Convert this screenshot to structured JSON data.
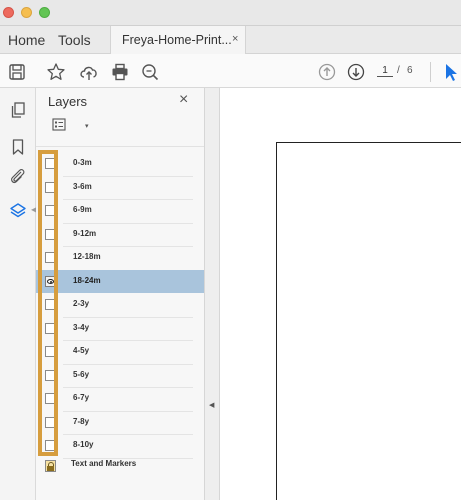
{
  "window": {
    "colors": {
      "close": "#ed6a5e",
      "minimize": "#f5be4f",
      "zoom": "#62c554"
    }
  },
  "menubar": {
    "home_label": "Home",
    "tools_label": "Tools",
    "tab": {
      "label": "Freya-Home-Print...",
      "close": "×"
    }
  },
  "toolbar": {
    "icons": [
      "save-icon",
      "bookmark-star-icon",
      "upload-cloud-icon",
      "print-icon",
      "zoom-search-icon",
      "page-up-icon",
      "page-down-icon",
      "select-cursor-icon"
    ],
    "current_page": "1",
    "separator": "/",
    "total_pages": "6",
    "accent_color": "#1b74e4"
  },
  "leftrail": {
    "icons": [
      "pages-icon",
      "bookmark-icon",
      "attachment-icon",
      "layers-icon"
    ],
    "active": "layers-icon"
  },
  "panel": {
    "title": "Layers",
    "close": "×",
    "options_caret": "▾",
    "layers": [
      {
        "label": "0-3m",
        "visible": false
      },
      {
        "label": "3-6m",
        "visible": false
      },
      {
        "label": "6-9m",
        "visible": false
      },
      {
        "label": "9-12m",
        "visible": false
      },
      {
        "label": "12-18m",
        "visible": false
      },
      {
        "label": "18-24m",
        "visible": true,
        "selected": true
      },
      {
        "label": "2-3y",
        "visible": false
      },
      {
        "label": "3-4y",
        "visible": false
      },
      {
        "label": "4-5y",
        "visible": false
      },
      {
        "label": "5-6y",
        "visible": false
      },
      {
        "label": "6-7y",
        "visible": false
      },
      {
        "label": "7-8y",
        "visible": false
      },
      {
        "label": "8-10y",
        "visible": false
      }
    ],
    "markers_label": "Text and Markers",
    "selected_color": "#a9c4dc",
    "highlight_color": "#d69d3e"
  },
  "splitter": {
    "arrow": "◀"
  }
}
